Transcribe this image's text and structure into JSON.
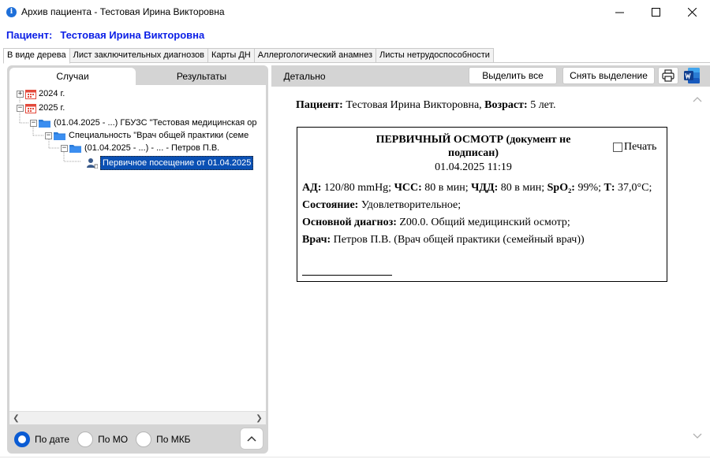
{
  "window": {
    "title": "Архив пациента - Тестовая Ирина Викторовна",
    "icon": "info-icon"
  },
  "patient_header": {
    "label": "Пациент:",
    "name": "Тестовая Ирина Викторовна"
  },
  "tabs": [
    {
      "label": "В виде дерева",
      "active": true
    },
    {
      "label": "Лист заключительных диагнозов",
      "active": false
    },
    {
      "label": "Карты ДН",
      "active": false
    },
    {
      "label": "Аллергологический анамнез",
      "active": false
    },
    {
      "label": "Листы нетрудоспособности",
      "active": false
    }
  ],
  "left_panel": {
    "subtabs": [
      "Случаи",
      "Результаты"
    ],
    "tree": [
      {
        "label": "2024 г.",
        "icon": "calendar-icon",
        "expander": "+"
      },
      {
        "label": "2025 г.",
        "icon": "calendar-icon",
        "expander": "−"
      },
      {
        "label": "(01.04.2025 - ...) ГБУЗС \"Тестовая медицинская ор",
        "icon": "folder-icon",
        "expander": "−"
      },
      {
        "label": "Специальность \"Врач общей практики (семе",
        "icon": "folder-icon",
        "expander": "−"
      },
      {
        "label": "(01.04.2025 - ...) - ... - Петров П.В.",
        "icon": "folder-icon",
        "expander": "−"
      },
      {
        "label": "Первичное посещение от 01.04.2025",
        "icon": "doctor-document-icon",
        "selected": true
      }
    ],
    "sort": {
      "options": [
        "По дате",
        "По МО",
        "По МКБ"
      ],
      "selected": "По дате"
    }
  },
  "right_panel": {
    "detail_tab": "Детально",
    "buttons": {
      "select_all": "Выделить все",
      "deselect": "Снять выделение",
      "print_icon": "printer-icon",
      "word_icon": "word-icon"
    },
    "document": {
      "patient_label": "Пациент:",
      "patient_name": "Тестовая Ирина Викторовна,",
      "age_label": "Возраст:",
      "age_value": "5 лет.",
      "card_title": "ПЕРВИЧНЫЙ ОСМОТР (документ не подписан)",
      "card_date": "01.04.2025 11:19",
      "print_label": "Печать",
      "vitals": {
        "ad_label": "АД:",
        "ad_value": "120/80 mmHg;",
        "hr_label": "ЧСС:",
        "hr_value": "80 в мин;",
        "rr_label": "ЧДД:",
        "rr_value": "80 в мин;",
        "spo2_label": "SpO₂:",
        "spo2_value": "99%;",
        "t_label": "Т:",
        "t_value": "37,0°C;"
      },
      "state_label": "Состояние:",
      "state_value": "Удовлетворительное;",
      "diagnosis_label": "Основной диагноз:",
      "diagnosis_value": "Z00.0. Общий медицинский осмотр;",
      "doctor_label": "Врач:",
      "doctor_value": "Петров П.В. (Врач общей практики (семейный врач))"
    }
  },
  "colors": {
    "accent": "#0a5bd3",
    "patient_header": "#0a1ee6",
    "selection": "#0a50b4",
    "folder": "#2a7bd8",
    "calendar": "#e34a3c",
    "panel_bg": "#d4d4d4"
  }
}
